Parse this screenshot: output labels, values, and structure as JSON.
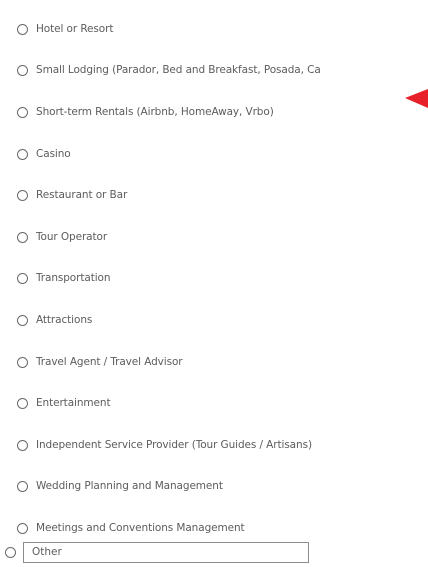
{
  "options": [
    {
      "label": "Hotel or Resort",
      "selected": false
    },
    {
      "label": "Small Lodging (Parador, Bed and Breakfast, Posada, Ca",
      "selected": false
    },
    {
      "label": "Short-term Rentals (Airbnb, HomeAway, Vrbo)",
      "selected": false
    },
    {
      "label": "Casino",
      "selected": false
    },
    {
      "label": "Restaurant or Bar",
      "selected": false
    },
    {
      "label": "Tour Operator",
      "selected": false
    },
    {
      "label": "Transportation",
      "selected": false
    },
    {
      "label": "Attractions",
      "selected": false
    },
    {
      "label": "Travel Agent / Travel Advisor",
      "selected": false
    },
    {
      "label": "Entertainment",
      "selected": false
    },
    {
      "label": "Independent Service Provider (Tour Guides / Artisans)",
      "selected": false
    },
    {
      "label": "Wedding Planning and Management",
      "selected": false
    },
    {
      "label": "Meetings and Conventions Management",
      "selected": false
    }
  ],
  "other": {
    "placeholder": "Other",
    "value": "",
    "selected": false
  },
  "colors": {
    "arrow": "#e8202a",
    "text": "#5c5c5c",
    "radio_border": "#6a6a6a",
    "input_border": "#8c8c8c"
  },
  "icons": {
    "annotation": "red-arrow-icon"
  }
}
